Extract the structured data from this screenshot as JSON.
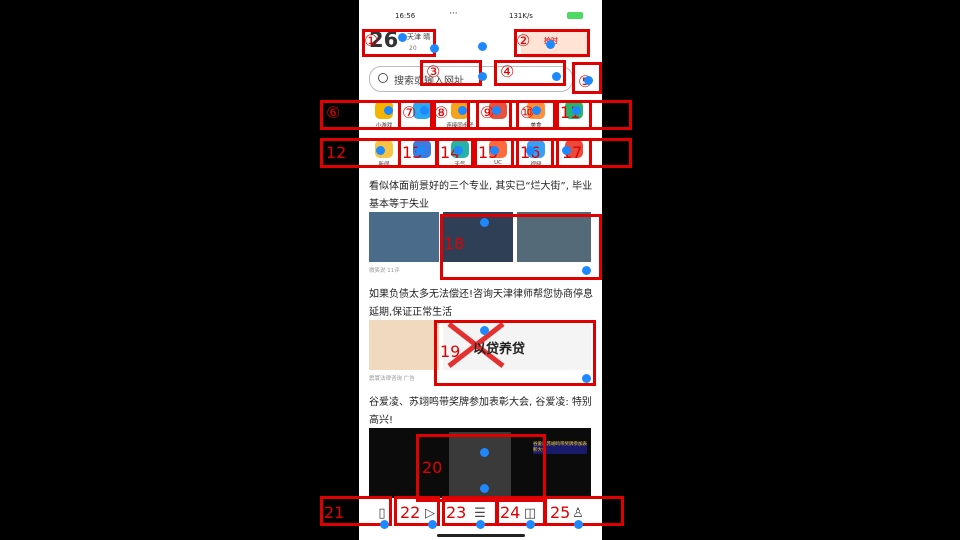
{
  "status_bar": {
    "time": "16:56",
    "dots": "···",
    "speed": "131K/s"
  },
  "weather": {
    "temp": "26",
    "city": "天津 晴",
    "aqi": "20"
  },
  "banner": {
    "text": "抢时"
  },
  "search": {
    "placeholder": "搜索或输入网址"
  },
  "grid_row1": [
    {
      "label": "小游戏",
      "color": "#f4b400"
    },
    {
      "label": "",
      "color": "#2aa8f2"
    },
    {
      "label": "连接同步子",
      "color": "#f7a21b"
    },
    {
      "label": "",
      "color": "#e8513c"
    },
    {
      "label": "美食",
      "color": "#ff8f3a"
    },
    {
      "label": "",
      "color": "#26b56c"
    }
  ],
  "grid_row2": [
    {
      "label": "新闻",
      "color": "#f6c445"
    },
    {
      "label": "",
      "color": "#3a7be0"
    },
    {
      "label": "天气",
      "color": "#24b3a6"
    },
    {
      "label": "UC",
      "color": "#ff6a3d"
    },
    {
      "label": "视频",
      "color": "#37a0f4"
    },
    {
      "label": "",
      "color": "#e94c3d"
    }
  ],
  "feed": [
    {
      "title": "看似体面前景好的三个专业, 其实已“烂大街”, 毕业基本等于失业",
      "meta": "微笑说  11评"
    },
    {
      "title": "如果负债太多无法偿还!咨询天津律师帮您协商停息延期,保证正常生活",
      "meta": "震寰法律咨询  广告",
      "graphic": "以贷养贷"
    },
    {
      "title": "谷爱凌、苏翊鸣带奖牌参加表彰大会, 谷爱凌: 特别高兴!",
      "video_caption": "谷爱凌苏翊鸣带奖牌参加表彰大会"
    }
  ],
  "tabs": [
    "home-icon",
    "play-icon",
    "menu-icon",
    "book-icon",
    "profile-icon"
  ],
  "annotations": [
    "①",
    "②",
    "③",
    "④",
    "⑤",
    "⑥",
    "⑦",
    "⑧",
    "⑨",
    "⑩",
    "11",
    "12",
    "13",
    "14",
    "15",
    "16",
    "17",
    "18",
    "19",
    "20",
    "21",
    "22",
    "23",
    "24",
    "25"
  ],
  "colors": {
    "annotation": "#e00000",
    "dot": "#1e88ff"
  }
}
